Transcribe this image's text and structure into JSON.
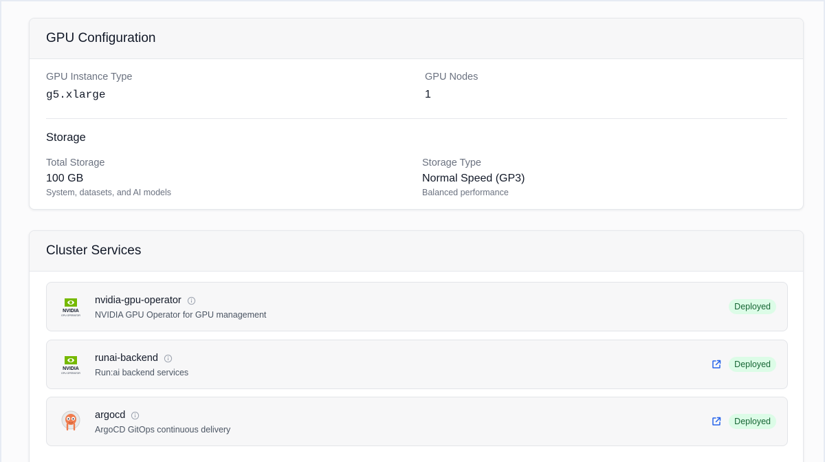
{
  "gpu_config": {
    "title": "GPU Configuration",
    "instance_type_label": "GPU Instance Type",
    "instance_type_value": "g5.xlarge",
    "nodes_label": "GPU Nodes",
    "nodes_value": "1",
    "storage_title": "Storage",
    "total_storage_label": "Total Storage",
    "total_storage_value": "100 GB",
    "total_storage_sub": "System, datasets, and AI models",
    "storage_type_label": "Storage Type",
    "storage_type_value": "Normal Speed (GP3)",
    "storage_type_sub": "Balanced performance"
  },
  "cluster_services": {
    "title": "Cluster Services",
    "services": [
      {
        "name": "nvidia-gpu-operator",
        "description": "NVIDIA GPU Operator for GPU management",
        "status": "Deployed",
        "logo": "nvidia-logo",
        "logo_text": "NVIDIA",
        "logo_sub": "GPU OPERATOR",
        "has_link": false
      },
      {
        "name": "runai-backend",
        "description": "Run:ai backend services",
        "status": "Deployed",
        "logo": "nvidia-logo",
        "logo_text": "NVIDIA",
        "logo_sub": "GPU OPERATOR",
        "has_link": true
      },
      {
        "name": "argocd",
        "description": "ArgoCD GitOps continuous delivery",
        "status": "Deployed",
        "logo": "argocd-logo",
        "has_link": true
      }
    ]
  },
  "colors": {
    "accent_link": "#2563eb",
    "badge_bg": "#dcfce7",
    "badge_text": "#166534",
    "nvidia_green": "#76b900"
  }
}
